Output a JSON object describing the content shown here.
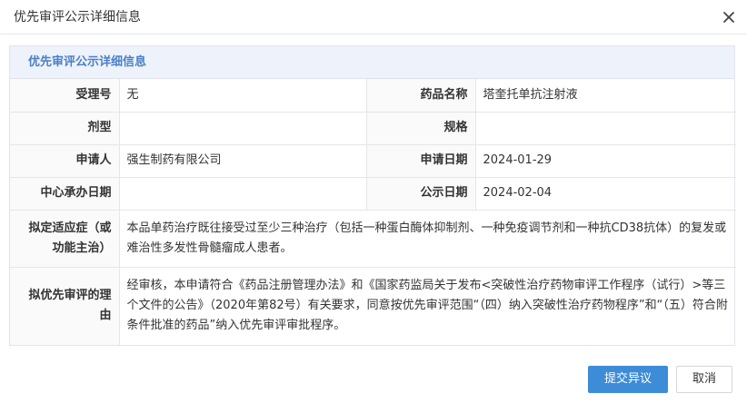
{
  "dialog": {
    "title": "优先审评公示详细信息",
    "close_icon": "close-icon"
  },
  "section": {
    "title": "优先审评公示详细信息"
  },
  "fields": {
    "accept_no_label": "受理号",
    "accept_no_value": "无",
    "drug_name_label": "药品名称",
    "drug_name_value": "塔奎托单抗注射液",
    "dosage_form_label": "剂型",
    "dosage_form_value": "",
    "spec_label": "规格",
    "spec_value": "",
    "applicant_label": "申请人",
    "applicant_value": "强生制药有限公司",
    "apply_date_label": "申请日期",
    "apply_date_value": "2024-01-29",
    "center_date_label": "中心承办日期",
    "center_date_value": "",
    "publish_date_label": "公示日期",
    "publish_date_value": "2024-02-04",
    "indication_label": "拟定适应症（或功能主治）",
    "indication_value": "本品单药治疗既往接受过至少三种治疗（包括一种蛋白酶体抑制剂、一种免疫调节剂和一种抗CD38抗体）的复发或难治性多发性骨髓瘤成人患者。",
    "reason_label": "拟优先审评的理由",
    "reason_value": "经审核，本申请符合《药品注册管理办法》和《国家药监局关于发布<突破性治疗药物审评工作程序（试行）>等三个文件的公告》（2020年第82号）有关要求，同意按优先审评范围“（四）纳入突破性治疗药物程序”和“（五）符合附条件批准的药品”纳入优先审评审批程序。"
  },
  "buttons": {
    "submit": "提交异议",
    "cancel": "取消"
  },
  "colors": {
    "primary": "#3c8cd8",
    "section_title": "#4a7fc7",
    "section_bg": "#eef3fb"
  }
}
